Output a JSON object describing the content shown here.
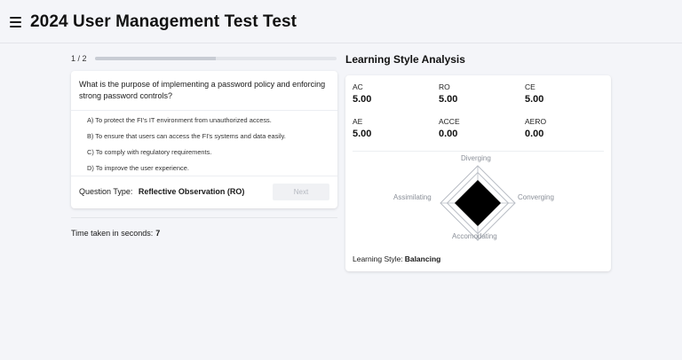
{
  "header": {
    "title": "2024 User Management Test Test"
  },
  "quiz": {
    "progress_label": "1 / 2",
    "progress_fraction": 0.5,
    "question": "What is the purpose of implementing a password policy and enforcing strong password controls?",
    "options": [
      "A) To protect the FI's IT environment from unauthorized access.",
      "B) To ensure that users can access the FI's systems and data easily.",
      "C) To comply with regulatory requirements.",
      "D) To improve the user experience."
    ],
    "question_type_label": "Question Type:",
    "question_type_value": "Reflective Observation (RO)",
    "next_label": "Next",
    "time_label": "Time taken in seconds:",
    "time_value": "7"
  },
  "analysis": {
    "title": "Learning Style Analysis",
    "metrics": [
      {
        "label": "AC",
        "value": "5.00"
      },
      {
        "label": "RO",
        "value": "5.00"
      },
      {
        "label": "CE",
        "value": "5.00"
      },
      {
        "label": "AE",
        "value": "5.00"
      },
      {
        "label": "ACCE",
        "value": "0.00"
      },
      {
        "label": "AERO",
        "value": "0.00"
      }
    ],
    "radar": {
      "axes": [
        "Diverging",
        "Converging",
        "Accomodating",
        "Assimilating"
      ],
      "values": [
        1,
        1,
        1,
        1
      ],
      "fill_color": "#000000",
      "grid_color": "#b8bcc4"
    },
    "learning_style_label": "Learning Style:",
    "learning_style_value": "Balancing"
  }
}
